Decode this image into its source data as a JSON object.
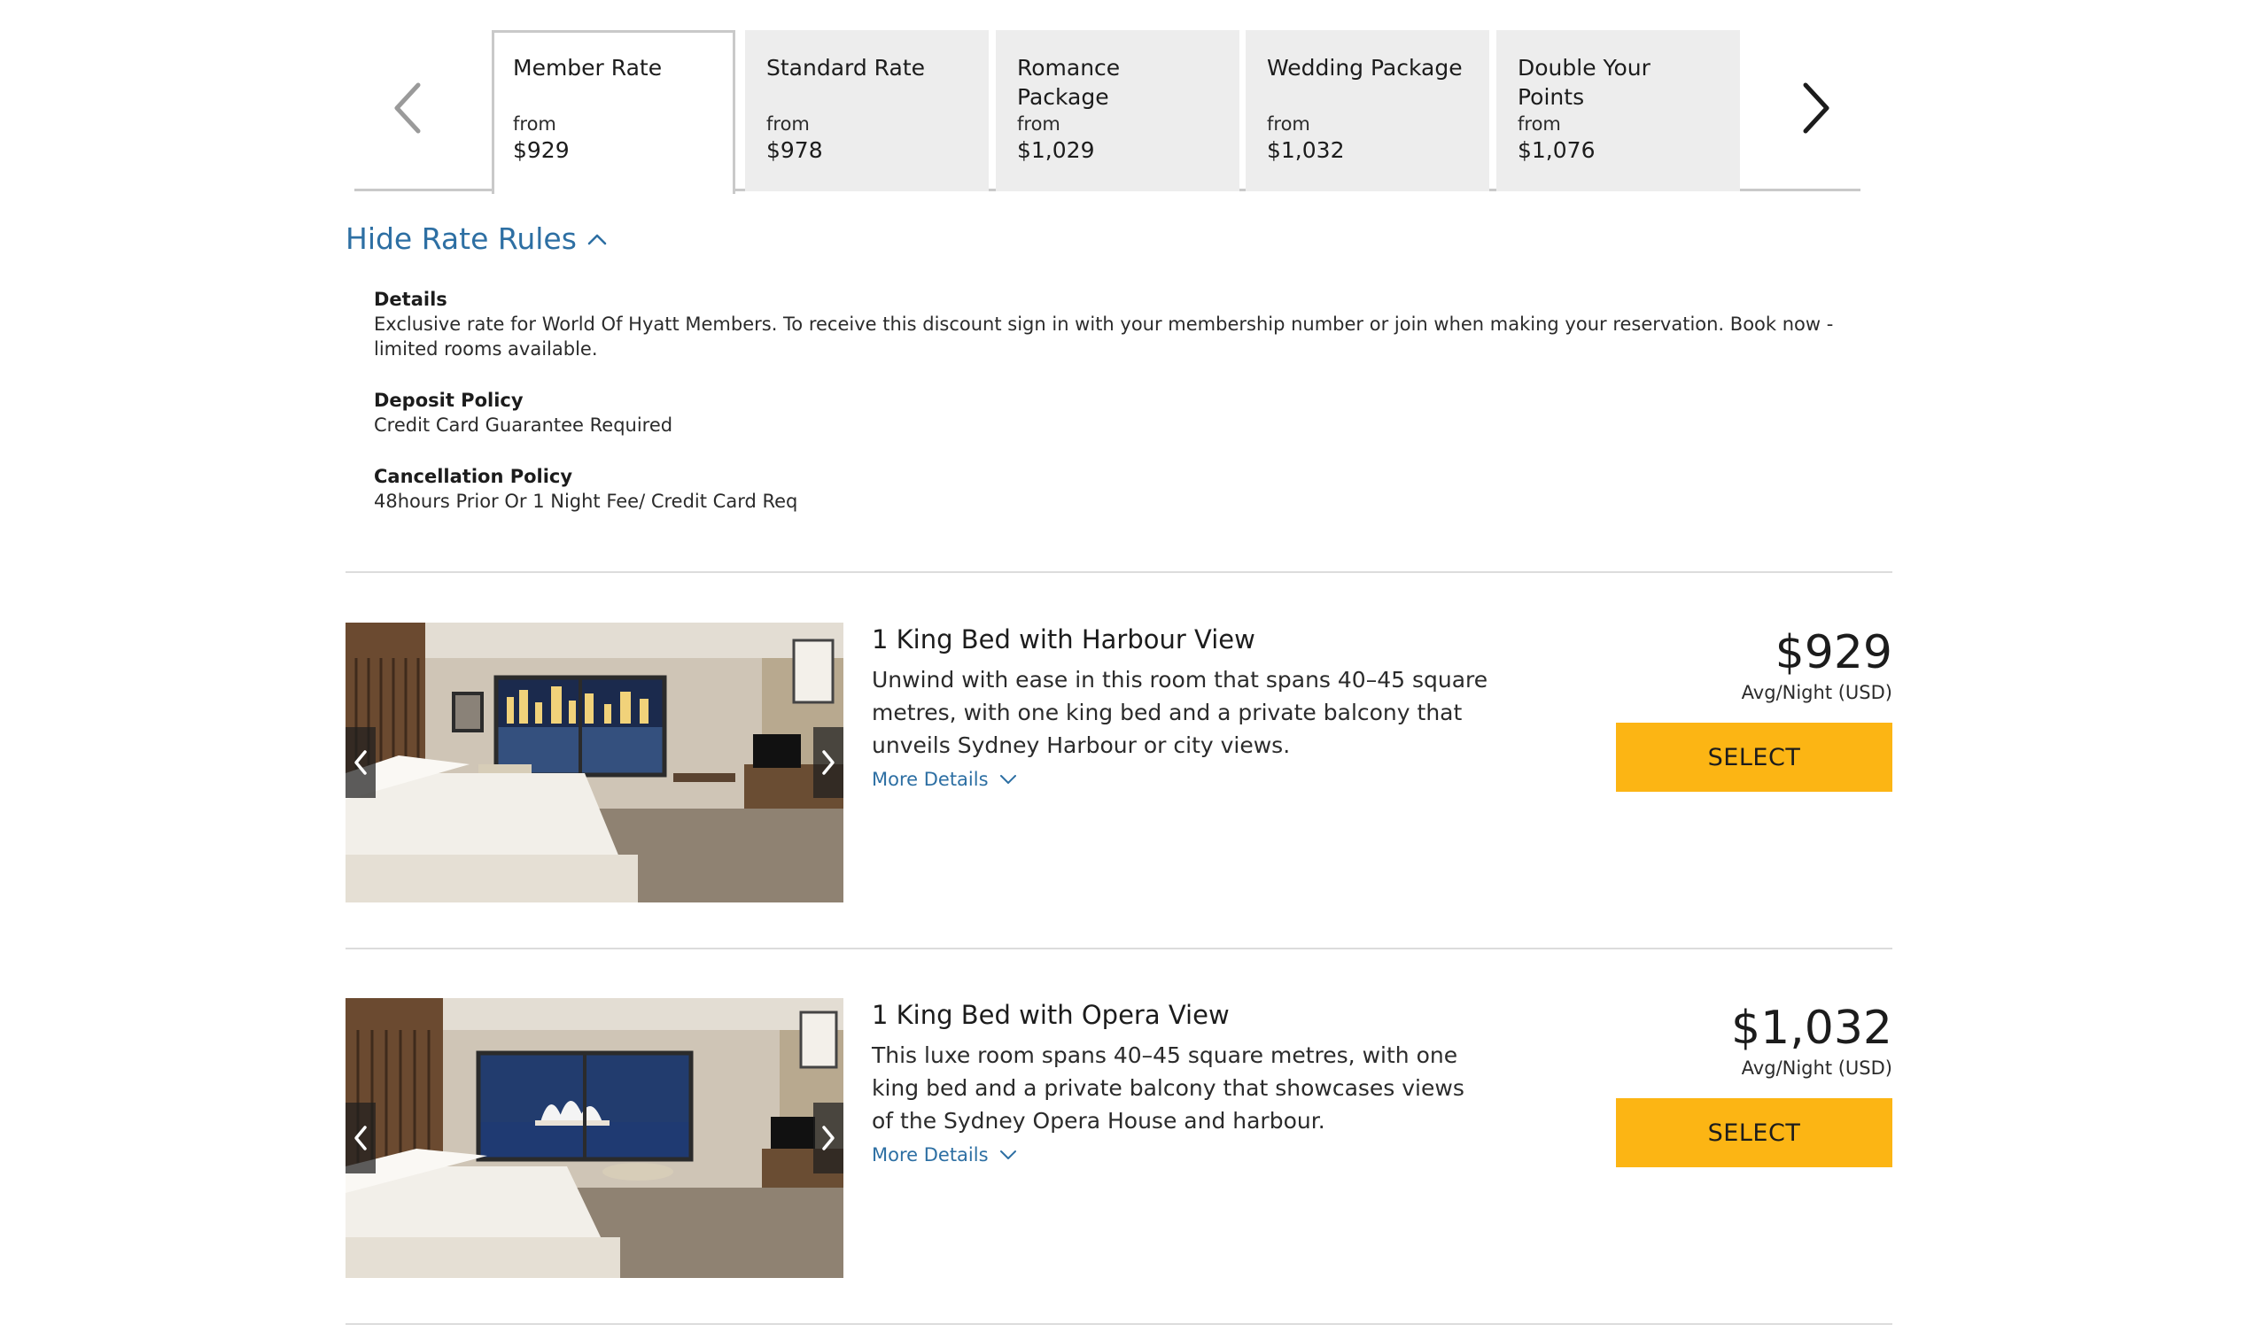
{
  "rate_tabs": [
    {
      "name": "Member Rate",
      "from": "from",
      "price": "$929",
      "active": true
    },
    {
      "name": "Standard Rate",
      "from": "from",
      "price": "$978",
      "active": false
    },
    {
      "name": "Romance Package",
      "from": "from",
      "price": "$1,029",
      "active": false
    },
    {
      "name": "Wedding Package",
      "from": "from",
      "price": "$1,032",
      "active": false
    },
    {
      "name": "Double Your Points",
      "from": "from",
      "price": "$1,076",
      "active": false
    }
  ],
  "rules": {
    "toggle_label": "Hide Rate Rules",
    "details_title": "Details",
    "details_text": "Exclusive rate for World Of Hyatt Members. To receive this discount sign in with your membership number or join when making your reservation. Book now - limited rooms available.",
    "deposit_title": "Deposit Policy",
    "deposit_text": "Credit Card Guarantee Required",
    "cancellation_title": "Cancellation Policy",
    "cancellation_text": "48hours Prior Or 1 Night Fee/ Credit Card Req"
  },
  "rooms": [
    {
      "title": "1 King Bed with Harbour View",
      "description": "Unwind with ease in this room that spans 40–45 square metres, with one king bed and a private balcony that unveils Sydney Harbour or city views.",
      "more_details": "More Details",
      "price": "$929",
      "price_note": "Avg/Night (USD)",
      "select_label": "SELECT"
    },
    {
      "title": "1 King Bed with Opera View",
      "description": "This luxe room spans 40–45 square metres, with one king bed and a private balcony that showcases views of the Sydney Opera House and harbour.",
      "more_details": "More Details",
      "price": "$1,032",
      "price_note": "Avg/Night (USD)",
      "select_label": "SELECT"
    }
  ],
  "colors": {
    "accent_link": "#2d6fa3",
    "select_button": "#fcb514",
    "tab_inactive": "#ededed"
  },
  "icons": {
    "tab_prev": "chevron-left-icon",
    "tab_next": "chevron-right-icon",
    "rules_toggle": "chevron-up-icon",
    "more_details": "chevron-down-icon"
  }
}
